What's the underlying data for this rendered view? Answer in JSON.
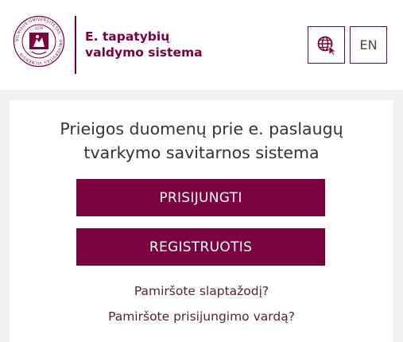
{
  "header": {
    "logo": {
      "seal_text": "VILNIAUS UNIVERSITETAS · UNIVERSITAS VILNENSIS",
      "seal_year": "1579",
      "title_line1": "E. tapatybių",
      "title_line2": "valdymo sistema"
    },
    "language": {
      "globe_icon": "globe-icon",
      "en_label": "EN"
    }
  },
  "card": {
    "title_line1": "Prieigos duomenų prie e. paslaugų",
    "title_line2": "tvarkymo savitarnos sistema",
    "login_label": "PRISIJUNGTI",
    "register_label": "REGISTRUOTIS",
    "forgot_password": "Pamiršote slaptažodį?",
    "forgot_username": "Pamiršote prisijungimo vardą?"
  },
  "colors": {
    "brand": "#7a0040",
    "background": "#f0f0f0",
    "text": "#333333"
  }
}
